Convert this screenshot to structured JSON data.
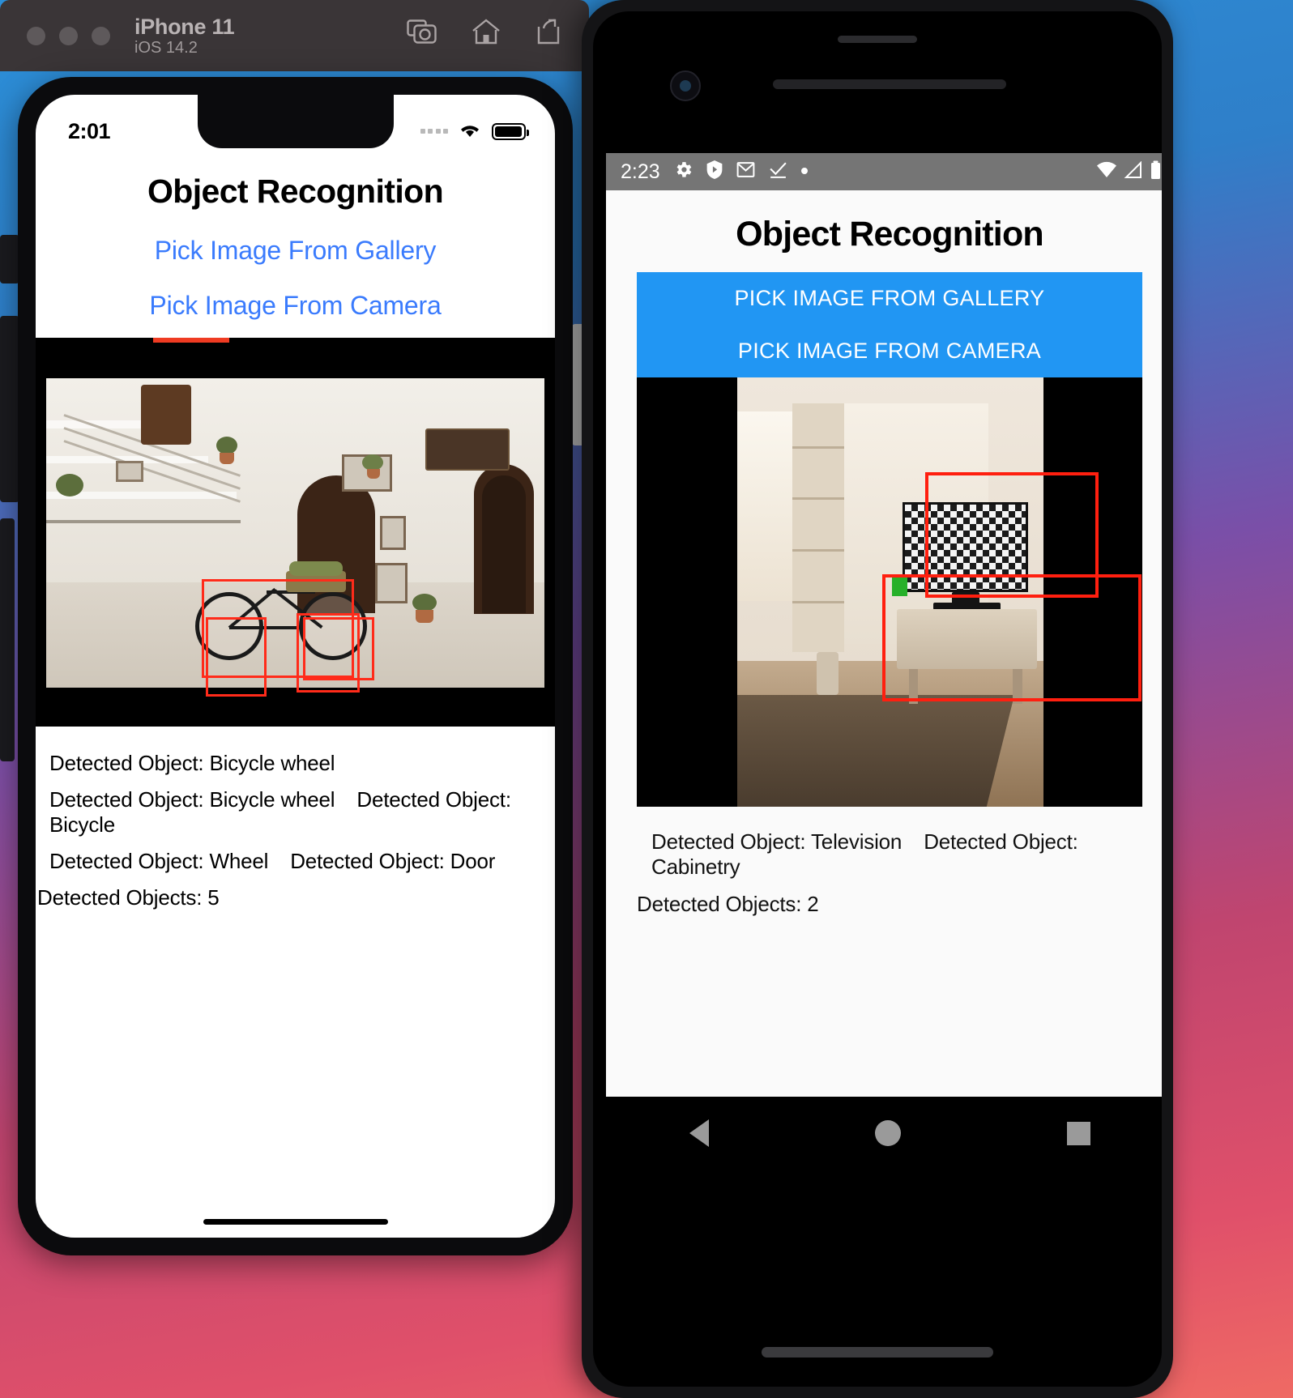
{
  "simulator_window": {
    "device_name": "iPhone 11",
    "os_version": "iOS 14.2",
    "toolbar_icons": [
      "screenshot-camera-icon",
      "home-icon",
      "share-rotate-icon"
    ]
  },
  "ios": {
    "status_bar": {
      "time": "2:01",
      "cellular": "signal-dots-icon",
      "wifi": "wifi-icon",
      "battery": "battery-icon"
    },
    "app_title": "Object Recognition",
    "buttons": [
      {
        "label": "Pick Image From Gallery",
        "name": "pick-image-from-gallery"
      },
      {
        "label": "Pick Image From Camera",
        "name": "pick-image-from-camera"
      }
    ],
    "detections": [
      "Detected Object: Bicycle wheel",
      "Detected Object: Bicycle wheel",
      "Detected Object: Bicycle",
      "Detected Object: Wheel",
      "Detected Object: Door"
    ],
    "detected_count_label": "Detected Objects: 5",
    "accent_link_color": "#3a7bfd",
    "bbox_color": "#ff2b1a"
  },
  "android": {
    "status_bar": {
      "time": "2:23",
      "icons": [
        "gear-icon",
        "shield-icon",
        "gmail-icon",
        "download-complete-icon",
        "dot-icon"
      ],
      "right_icons": [
        "wifi-icon",
        "cellular-signal-icon",
        "battery-icon"
      ]
    },
    "app_title": "Object Recognition",
    "buttons": [
      {
        "label": "PICK IMAGE FROM GALLERY",
        "name": "pick-image-from-gallery"
      },
      {
        "label": "PICK IMAGE FROM CAMERA",
        "name": "pick-image-from-camera"
      }
    ],
    "detections": [
      "Detected Object: Television",
      "Detected Object: Cabinetry"
    ],
    "detected_count_label": "Detected Objects: 2",
    "button_color": "#2196F3",
    "bbox_color": "#ff1f0f",
    "nav_buttons": [
      "back-icon",
      "home-icon",
      "recents-icon"
    ]
  }
}
